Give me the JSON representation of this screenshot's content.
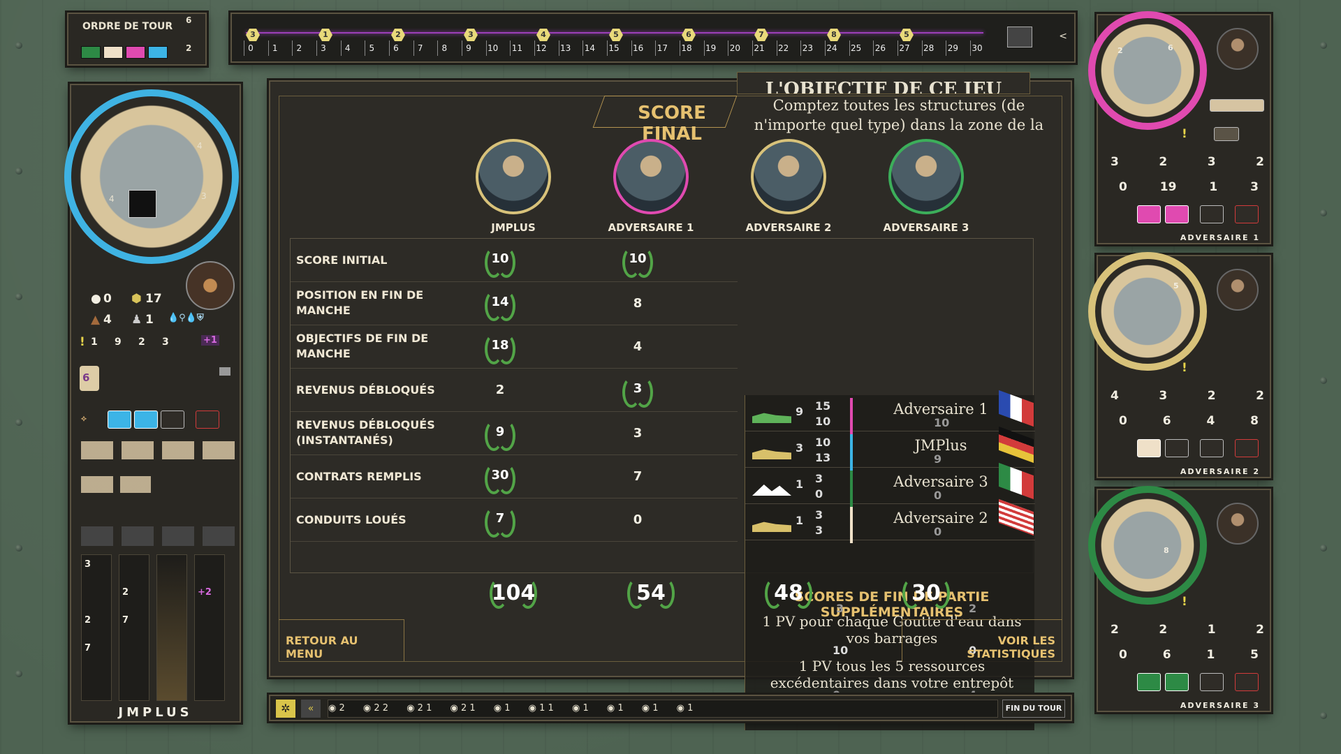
{
  "turn_order": {
    "label": "ORDRE DE TOUR",
    "colors": [
      "#2d8a45",
      "#efe0c8",
      "#e04ab0",
      "#3cb4e6"
    ]
  },
  "track": {
    "round_badges": [
      "6",
      "2"
    ],
    "ticks": [
      "0",
      "1",
      "2",
      "3",
      "4",
      "5",
      "6",
      "7",
      "8",
      "9",
      "10",
      "11",
      "12",
      "13",
      "14",
      "15",
      "16",
      "17",
      "18",
      "19",
      "20",
      "21",
      "22",
      "23",
      "24",
      "25",
      "26",
      "27",
      "28",
      "29",
      "30"
    ],
    "badge_values": [
      "3",
      "1",
      "2",
      "3",
      "4",
      "5",
      "6",
      "7",
      "8",
      "5"
    ]
  },
  "modal": {
    "title": "SCORE FINAL",
    "objective_title": "L'OBJECTIF DE CE JEU",
    "objective_text": "Comptez toutes les structures (de n'importe quel type) dans la zone de la",
    "players": [
      {
        "name": "JMPLUS",
        "ring": "#d8c27a"
      },
      {
        "name": "ADVERSAIRE 1",
        "ring": "#e04ab0"
      },
      {
        "name": "ADVERSAIRE 2",
        "ring": "#d8c27a"
      },
      {
        "name": "ADVERSAIRE 3",
        "ring": "#3cae5a"
      }
    ],
    "rows": [
      {
        "label": "SCORE INITIAL",
        "values": [
          "10",
          "10"
        ],
        "laurels": [
          true,
          true
        ]
      },
      {
        "label": "POSITION EN FIN DE MANCHE",
        "values": [
          "14",
          "8"
        ],
        "laurels": [
          true,
          false
        ]
      },
      {
        "label": "OBJECTIFS DE FIN DE MANCHE",
        "values": [
          "18",
          "4"
        ],
        "laurels": [
          true,
          false
        ]
      },
      {
        "label": "REVENUS DÉBLOQUÉS",
        "values": [
          "2",
          "3"
        ],
        "laurels": [
          false,
          true
        ]
      },
      {
        "label": "REVENUS DÉBLOQUÉS (INSTANTANÉS)",
        "values": [
          "9",
          "3"
        ],
        "laurels": [
          true,
          false
        ]
      },
      {
        "label": "CONTRATS REMPLIS",
        "values": [
          "30",
          "7"
        ],
        "laurels": [
          true,
          false
        ]
      },
      {
        "label": "CONDUITS LOUÉS",
        "values": [
          "7",
          "0"
        ],
        "laurels": [
          true,
          false
        ]
      }
    ],
    "totals": [
      "104",
      "54",
      "48",
      "30"
    ],
    "ranking": [
      {
        "name": "Adversaire 1",
        "n1": "9",
        "n2": "15",
        "n3": "10",
        "n4": "10",
        "bar": "#e04ab0"
      },
      {
        "name": "JMPlus",
        "n1": "3",
        "n2": "10",
        "n3": "13",
        "n4": "9",
        "bar": "#3cb4e6"
      },
      {
        "name": "Adversaire 3",
        "n1": "1",
        "n2": "3",
        "n3": "0",
        "n4": "0",
        "bar": "#2d8a45"
      },
      {
        "name": "Adversaire 2",
        "n1": "1",
        "n2": "3",
        "n3": "3",
        "n4": "0",
        "bar": "#efe0c8"
      }
    ],
    "extra_title": "SCORES DE FIN DE PARTIE SUPPLÉMENTAIRES",
    "extra_line1": "1 PV pour chaque Goutte d'eau dans vos barrages",
    "extra_vals1": [
      "3",
      "2"
    ],
    "extra_line2": "1 PV tous les 5 ressources excédentaires dans votre entrepôt (Bétonnières, Excavatrices, Crédits)",
    "extra_vals2": [
      "10",
      "0",
      "0",
      "4"
    ],
    "back_button": "RETOUR AU MENU",
    "stats_button": "VOIR LES STATISTIQUES"
  },
  "left_board": {
    "name": "JMPLUS",
    "wheel_numbers": [
      "4",
      "4",
      "3"
    ],
    "stats": [
      "0",
      "17",
      "4",
      "1"
    ],
    "counts": [
      "1",
      "9",
      "2",
      "3",
      "+1"
    ],
    "card_count": "6",
    "columns": [
      "3",
      "2",
      "2",
      "7",
      "7",
      "+2"
    ]
  },
  "opponents": [
    {
      "name": "ADVERSAIRE 1",
      "color": "#e04ab0",
      "builds": [
        "3",
        "2",
        "3",
        "2"
      ],
      "stats": [
        "0",
        "19",
        "1",
        "3"
      ],
      "wheel": [
        "2",
        "6"
      ]
    },
    {
      "name": "ADVERSAIRE 2",
      "color": "#d8c27a",
      "builds": [
        "4",
        "3",
        "2",
        "2"
      ],
      "stats": [
        "0",
        "6",
        "4",
        "8"
      ],
      "wheel": [
        "5"
      ]
    },
    {
      "name": "ADVERSAIRE 3",
      "color": "#2d8a45",
      "builds": [
        "2",
        "2",
        "1",
        "2"
      ],
      "stats": [
        "0",
        "6",
        "1",
        "5"
      ],
      "wheel": [
        "8"
      ]
    }
  ],
  "log": {
    "entries": [
      "2",
      "2 2",
      "2 1",
      "2 1",
      "1",
      "1 1",
      "1",
      "1",
      "1",
      "1"
    ],
    "end_turn": "FIN DU TOUR"
  }
}
